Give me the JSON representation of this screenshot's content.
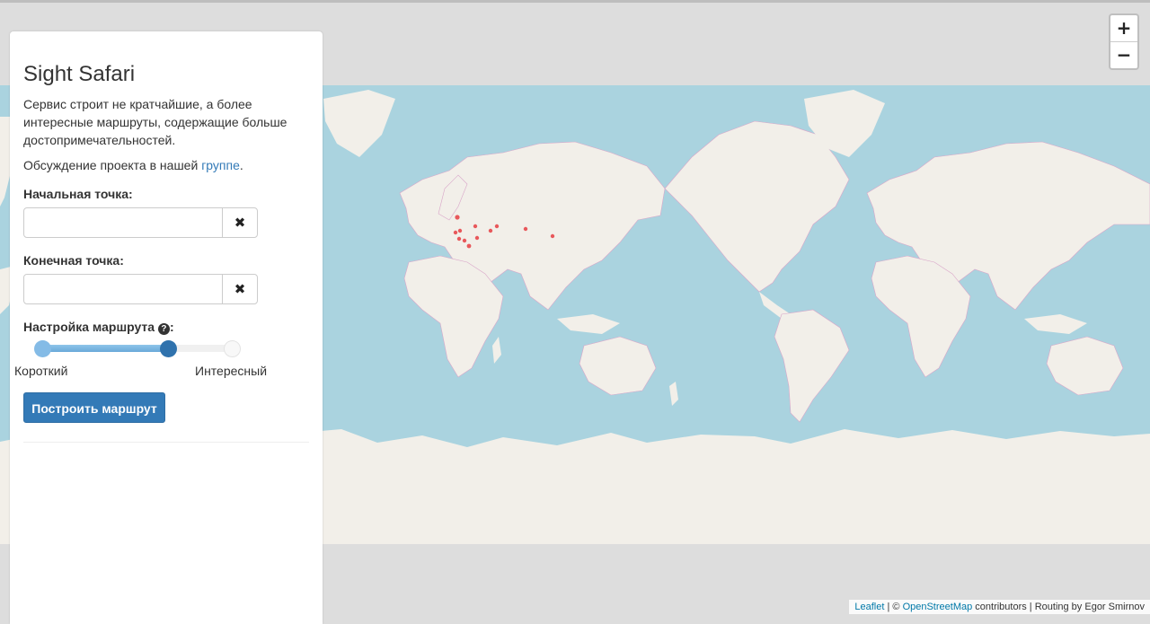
{
  "app": {
    "title": "Sight Safari",
    "description": "Сервис строит не кратчайшие, а более интересные маршруты, содержащие больше достопримечательностей.",
    "discussion_prefix": "Обсуждение проекта в нашей",
    "discussion_link": "группе",
    "discussion_suffix": "."
  },
  "form": {
    "start_label": "Начальная точка:",
    "start_value": "",
    "end_label": "Конечная точка:",
    "end_value": "",
    "clear_glyph": "✖",
    "route_setting_label": "Настройка маршрута",
    "help_glyph": "?",
    "help_suffix": ":",
    "slider_min_label": "Короткий",
    "slider_max_label": "Интересный",
    "slider_level": 0.66,
    "build_button": "Построить маршрут"
  },
  "map": {
    "zoom_in": "+",
    "zoom_out": "−",
    "attribution": {
      "leaflet": "Leaflet",
      "sep1": " | © ",
      "osm": "OpenStreetMap",
      "contributors": " contributors | Routing by Egor Smirnov"
    },
    "colors": {
      "ocean": "#aad3df",
      "land": "#f2efe9",
      "border": "#d9a6c9",
      "marker": "#e8585b"
    }
  },
  "icons": {
    "clear": "times-icon",
    "help": "question-circle-icon"
  }
}
